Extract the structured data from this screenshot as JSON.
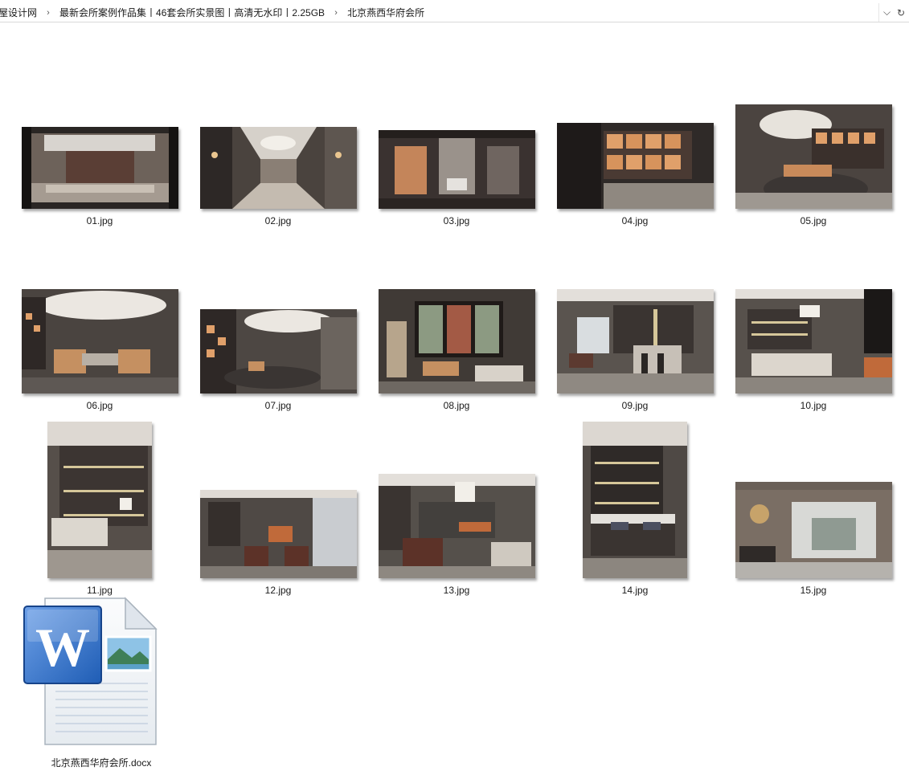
{
  "breadcrumb": {
    "items": [
      "屋设计网",
      "最新会所案例作品集丨46套会所实景图丨高清无水印丨2.25GB",
      "北京燕西华府会所"
    ],
    "separator": "›",
    "dropdown_glyph": "⌵",
    "refresh_glyph": "↻"
  },
  "files": [
    {
      "name": "01.jpg"
    },
    {
      "name": "02.jpg"
    },
    {
      "name": "03.jpg"
    },
    {
      "name": "04.jpg"
    },
    {
      "name": "05.jpg"
    },
    {
      "name": "06.jpg"
    },
    {
      "name": "07.jpg"
    },
    {
      "name": "08.jpg"
    },
    {
      "name": "09.jpg"
    },
    {
      "name": "10.jpg"
    },
    {
      "name": "11.jpg"
    },
    {
      "name": "12.jpg"
    },
    {
      "name": "13.jpg"
    },
    {
      "name": "14.jpg"
    },
    {
      "name": "15.jpg"
    }
  ],
  "document": {
    "name": "北京燕西华府会所.docx",
    "icon": "word-document-icon",
    "icon_letter": "W"
  },
  "colors": {
    "word_blue": "#1f5db5",
    "interior_dark": "#3a3533",
    "warm_light": "#e0a06a"
  }
}
